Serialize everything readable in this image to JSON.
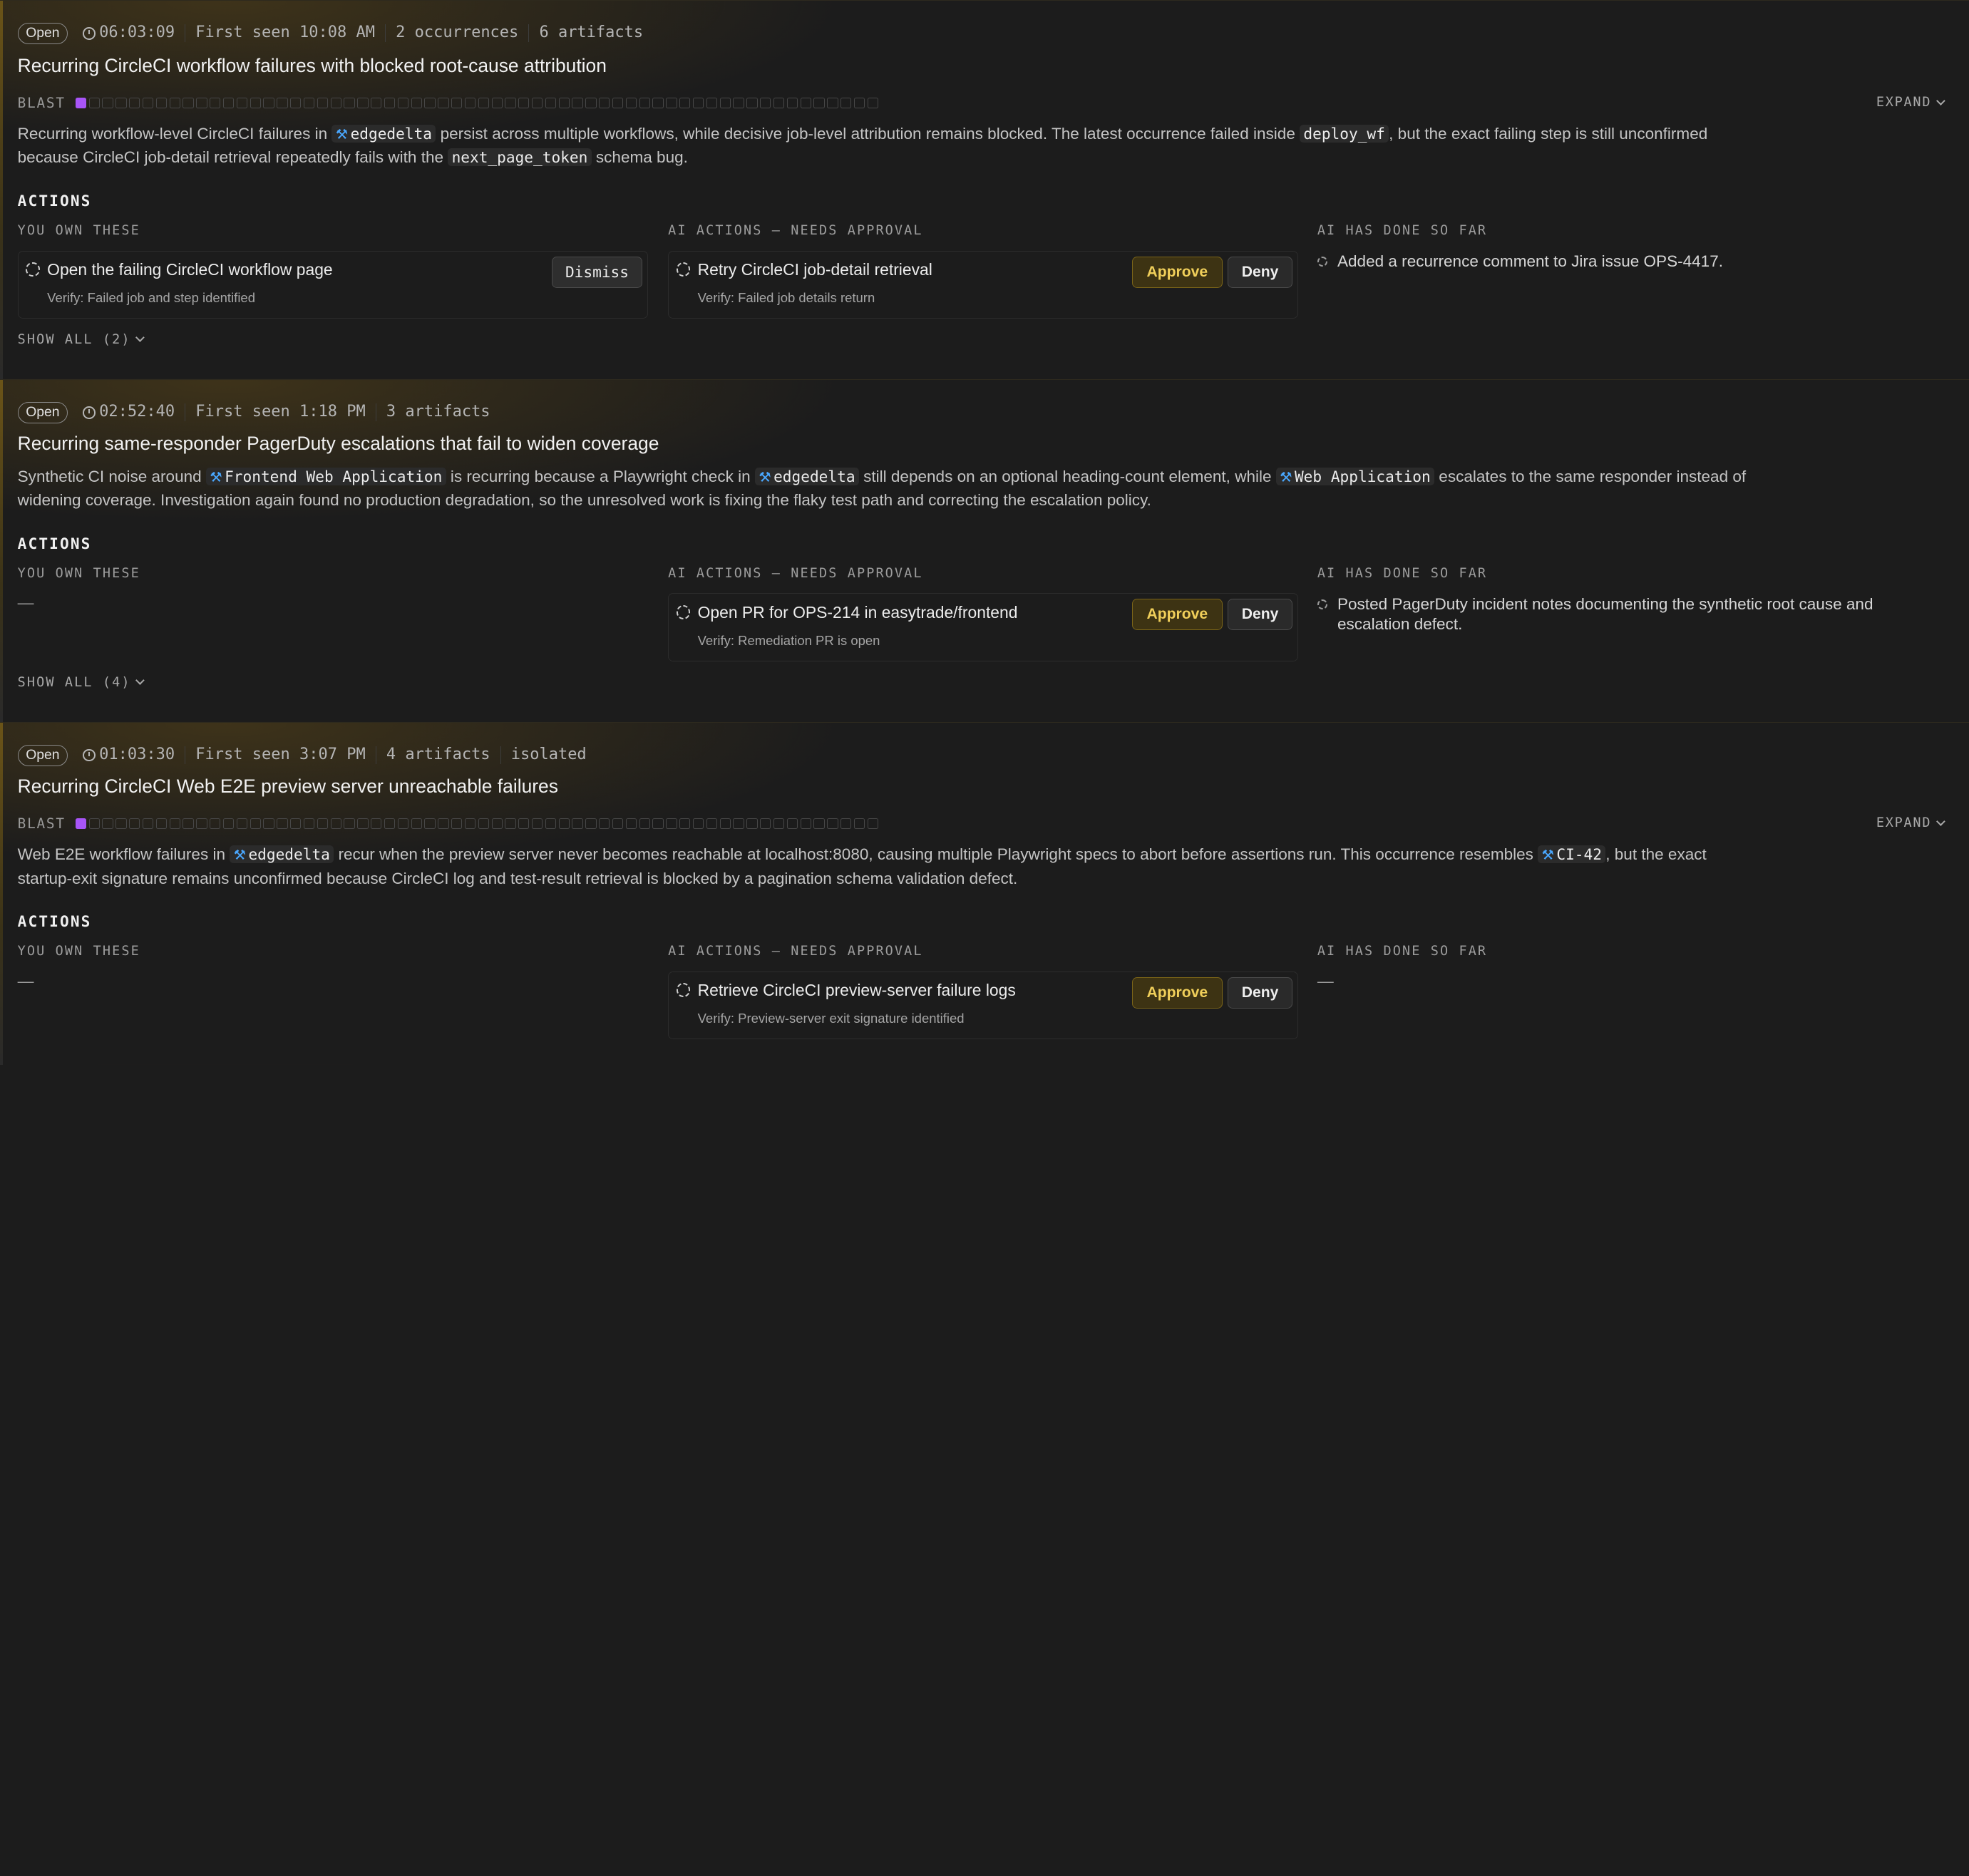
{
  "incidents": [
    {
      "status": "Open",
      "timer": "06:03:09",
      "meta": [
        "First seen 10:08 AM",
        "2 occurrences",
        "6 artifacts"
      ],
      "title": "Recurring CircleCI workflow failures with blocked root-cause attribution",
      "blast_label": "BLAST",
      "blast_level": 1,
      "expand_label": "EXPAND",
      "summary": {
        "p1": "Recurring workflow-level CircleCI failures in ",
        "c1": "edgedelta",
        "p2": " persist across multiple workflows, while decisive job-level attribution remains blocked. The latest occurrence failed inside ",
        "c2": "deploy_wf",
        "p3": ", but the exact failing step is still unconfirmed because CircleCI job-detail retrieval repeatedly fails with the ",
        "c3": "next_page_token",
        "p4": " schema bug."
      },
      "actions_heading": "ACTIONS",
      "col_own": "YOU OWN THESE",
      "col_ai": "AI ACTIONS – NEEDS APPROVAL",
      "col_done": "AI HAS DONE SO FAR",
      "own": {
        "label": "Open the failing CircleCI workflow page",
        "verify": "Verify: Failed job and step identified",
        "button": "Dismiss"
      },
      "ai": {
        "label": "Retry CircleCI job-detail retrieval",
        "verify": "Verify: Failed job details return",
        "approve": "Approve",
        "deny": "Deny"
      },
      "done": "Added a recurrence comment to Jira issue OPS-4417.",
      "show_all": "SHOW ALL (2)"
    },
    {
      "status": "Open",
      "timer": "02:52:40",
      "meta": [
        "First seen 1:18 PM",
        "3 artifacts"
      ],
      "title": "Recurring same-responder PagerDuty escalations that fail to widen coverage",
      "summary": {
        "p1": "Synthetic CI noise around ",
        "c1": "Frontend Web Application",
        "p2": " is recurring because a Playwright check in ",
        "c2": "edgedelta",
        "p3": " still depends on an optional heading-count element, while ",
        "c3": "Web Application",
        "p4": " escalates to the same responder instead of widening coverage. Investigation again found no production degradation, so the unresolved work is fixing the flaky test path and correcting the escalation policy."
      },
      "actions_heading": "ACTIONS",
      "col_own": "YOU OWN THESE",
      "col_ai": "AI ACTIONS – NEEDS APPROVAL",
      "col_done": "AI HAS DONE SO FAR",
      "own_empty": "—",
      "ai": {
        "label": "Open PR for OPS-214 in easytrade/frontend",
        "verify": "Verify: Remediation PR is open",
        "approve": "Approve",
        "deny": "Deny"
      },
      "done": "Posted PagerDuty incident notes documenting the synthetic root cause and escalation defect.",
      "show_all": "SHOW ALL (4)"
    },
    {
      "status": "Open",
      "timer": "01:03:30",
      "meta": [
        "First seen 3:07 PM",
        "4 artifacts",
        "isolated"
      ],
      "title": "Recurring CircleCI Web E2E preview server unreachable failures",
      "blast_label": "BLAST",
      "blast_level": 1,
      "expand_label": "EXPAND",
      "summary": {
        "p1": "Web E2E workflow failures in ",
        "c1": "edgedelta",
        "p2": " recur when the preview server never becomes reachable at localhost:8080, causing multiple Playwright specs to abort before assertions run. This occurrence resembles ",
        "c2": "CI-42",
        "p3": ", but the exact startup-exit signature remains unconfirmed because CircleCI log and test-result retrieval is blocked by a pagination schema validation defect."
      },
      "actions_heading": "ACTIONS",
      "col_own": "YOU OWN THESE",
      "col_ai": "AI ACTIONS – NEEDS APPROVAL",
      "col_done": "AI HAS DONE SO FAR",
      "own_empty": "—",
      "ai": {
        "label": "Retrieve CircleCI preview-server failure logs",
        "verify": "Verify: Preview-server exit signature identified",
        "approve": "Approve",
        "deny": "Deny"
      },
      "done_empty": "—"
    }
  ],
  "colors": {
    "accent_purple": "#a855f7",
    "approve_gold": "#f0cf5a",
    "tool_blue": "#4aa8ff"
  },
  "icons": [
    "timer-icon",
    "tool-icon",
    "spinner-icon",
    "chevron-down-icon"
  ]
}
